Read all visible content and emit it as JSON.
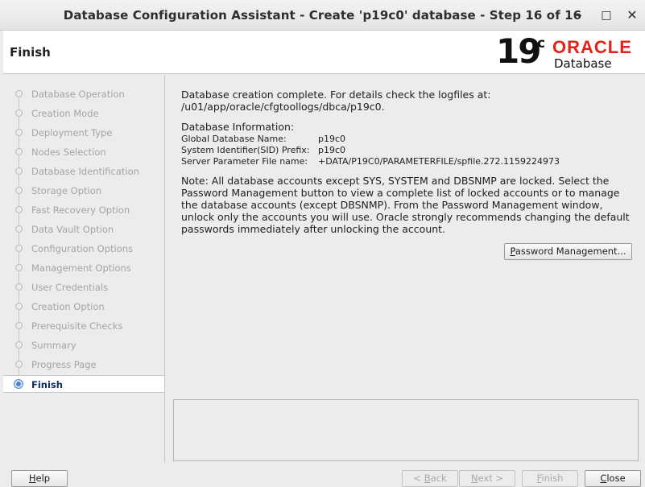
{
  "window": {
    "title": "Database Configuration Assistant - Create 'p19c0' database - Step 16 of 16",
    "controls": {
      "minimize": "–",
      "maximize": "□",
      "close": "✕"
    }
  },
  "header": {
    "step_title": "Finish",
    "logo": {
      "version": "19",
      "version_suffix": "c",
      "brand": "ORACLE",
      "product": "Database",
      "brand_color": "#e2231a"
    }
  },
  "nav": {
    "items": [
      {
        "label": "Database Operation"
      },
      {
        "label": "Creation Mode"
      },
      {
        "label": "Deployment Type"
      },
      {
        "label": "Nodes Selection"
      },
      {
        "label": "Database Identification"
      },
      {
        "label": "Storage Option"
      },
      {
        "label": "Fast Recovery Option"
      },
      {
        "label": "Data Vault Option"
      },
      {
        "label": "Configuration Options"
      },
      {
        "label": "Management Options"
      },
      {
        "label": "User Credentials"
      },
      {
        "label": "Creation Option"
      },
      {
        "label": "Prerequisite Checks"
      },
      {
        "label": "Summary"
      },
      {
        "label": "Progress Page"
      },
      {
        "label": "Finish"
      }
    ],
    "active": "Finish"
  },
  "content": {
    "complete_line1": "Database creation complete. For details check the logfiles at:",
    "complete_line2": " /u01/app/oracle/cfgtoollogs/dbca/p19c0.",
    "info_heading": "Database Information:",
    "info": {
      "global_name_label": "Global Database Name:",
      "global_name_value": "p19c0",
      "sid_label": "System Identifier(SID) Prefix:",
      "sid_value": "p19c0",
      "spfile_label": "Server Parameter File name:",
      "spfile_value": "+DATA/P19C0/PARAMETERFILE/spfile.272.1159224973"
    },
    "note_lines": [
      "Note: All database accounts except SYS, SYSTEM and DBSNMP are locked. Select the",
      "Password Management button to view a complete list of locked accounts or to manage",
      "the database accounts (except DBSNMP). From the Password Management window,",
      "unlock only the accounts you will use. Oracle strongly recommends changing the default",
      "passwords immediately after unlocking the account."
    ],
    "password_button": {
      "mnemonic": "P",
      "rest": "assword Management..."
    }
  },
  "footer": {
    "help": {
      "mnemonic": "H",
      "rest": "elp"
    },
    "back": {
      "prefix": "< ",
      "mnemonic": "B",
      "rest": "ack"
    },
    "next": {
      "mnemonic": "N",
      "rest": "ext >"
    },
    "finish": {
      "mnemonic": "F",
      "rest": "inish"
    },
    "close": {
      "mnemonic": "C",
      "rest": "lose"
    }
  }
}
